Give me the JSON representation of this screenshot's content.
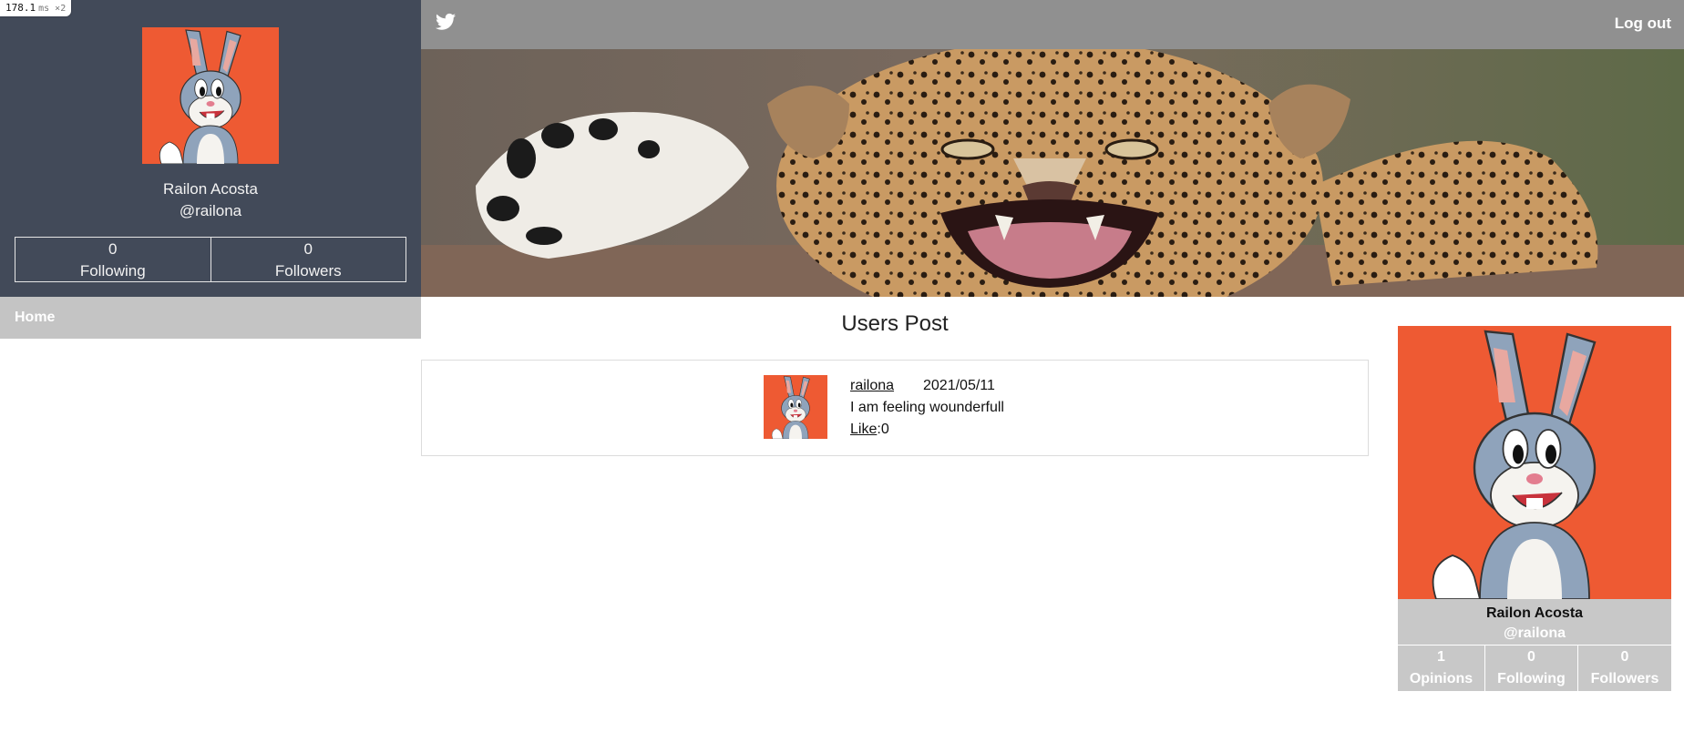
{
  "perf": {
    "value": "178.1",
    "unit": "ms ×2"
  },
  "sidebar": {
    "name": "Railon Acosta",
    "handle": "@railona",
    "following_count": "0",
    "following_label": "Following",
    "followers_count": "0",
    "followers_label": "Followers",
    "nav_home": "Home"
  },
  "header": {
    "logout": "Log out",
    "logo_icon": "twitter-bird-icon"
  },
  "main": {
    "title": "Users Post",
    "posts": [
      {
        "user": "railona",
        "date": "2021/05/11",
        "text": "I am feeling wounderfull",
        "like_label": "Like",
        "like_count": "0"
      }
    ]
  },
  "profile_card": {
    "name": "Railon Acosta",
    "handle": "@railona",
    "stats": [
      {
        "value": "1",
        "label": "Opinions"
      },
      {
        "value": "0",
        "label": "Following"
      },
      {
        "value": "0",
        "label": "Followers"
      }
    ]
  },
  "colors": {
    "sidebar_bg": "#424a59",
    "topbar_bg": "#909090",
    "nav_bg": "#c4c4c4",
    "card_bg": "#c8c8c8",
    "avatar_bg": "#ee5a33"
  }
}
